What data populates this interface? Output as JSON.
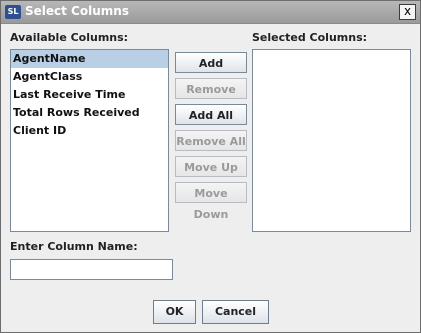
{
  "window": {
    "title": "Select Columns",
    "app_icon_text": "SL",
    "close_glyph": "x"
  },
  "available": {
    "label": "Available Columns:",
    "items": [
      "AgentName",
      "AgentClass",
      "Last Receive Time",
      "Total Rows Received",
      "Client ID"
    ],
    "selected_index": 0
  },
  "selected": {
    "label": "Selected Columns:",
    "items": []
  },
  "buttons": {
    "add": "Add",
    "remove": "Remove",
    "add_all": "Add All",
    "remove_all": "Remove All",
    "move_up": "Move Up",
    "move_down": "Move Down"
  },
  "column_name": {
    "label": "Enter Column Name:",
    "value": ""
  },
  "footer": {
    "ok": "OK",
    "cancel": "Cancel"
  }
}
